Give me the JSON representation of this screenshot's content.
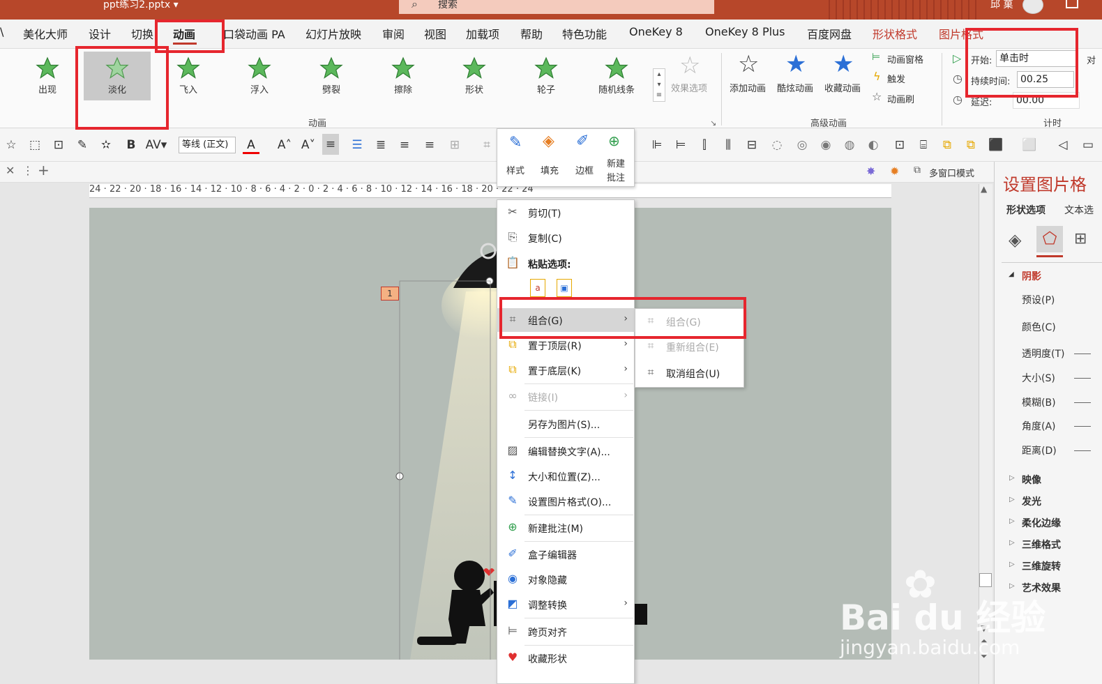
{
  "titlebar": {
    "doc_title": "ppt练习2.pptx ▾",
    "search_placeholder": "搜索",
    "user_name": "邱 菓"
  },
  "tabs": [
    {
      "label": "美化大师"
    },
    {
      "label": "设计"
    },
    {
      "label": "切换"
    },
    {
      "label": "动画"
    },
    {
      "label": "口袋动画 PA"
    },
    {
      "label": "幻灯片放映"
    },
    {
      "label": "审阅"
    },
    {
      "label": "视图"
    },
    {
      "label": "加载项"
    },
    {
      "label": "帮助"
    },
    {
      "label": "特色功能"
    },
    {
      "label": "OneKey 8"
    },
    {
      "label": "OneKey 8 Plus"
    },
    {
      "label": "百度网盘"
    },
    {
      "label": "形状格式"
    },
    {
      "label": "图片格式"
    }
  ],
  "ribbon": {
    "animations": [
      {
        "label": "出现"
      },
      {
        "label": "淡化"
      },
      {
        "label": "飞入"
      },
      {
        "label": "浮入"
      },
      {
        "label": "劈裂"
      },
      {
        "label": "擦除"
      },
      {
        "label": "形状"
      },
      {
        "label": "轮子"
      },
      {
        "label": "随机线条"
      }
    ],
    "effect_options": "效果选项",
    "group_animation": "动画",
    "add_animation": "添加动画",
    "cool_animation": "酷炫动画",
    "fav_animation": "收藏动画",
    "anim_pane": "动画窗格",
    "trigger": "触发",
    "anim_brush": "动画刷",
    "group_advanced": "高级动画",
    "start_label": "开始:",
    "start_value": "单击时",
    "duration_label": "持续时间:",
    "duration_value": "00.25",
    "delay_label": "延迟:",
    "delay_value": "00.00",
    "group_timing": "计时",
    "reorder_partial": "对"
  },
  "fmtbar": {
    "font_name": "等线 (正文)"
  },
  "tabstrip": {
    "multiwindow": "多窗口模式"
  },
  "ruler": {
    "text": "24 · 22 · 20 · 18 · 16 · 14 · 12 · 10 · 8 · 6 · 4 · 2 · 0 · 2 · 4 · 6 · 8 · 10 · 12 · 14 · 16 · 18 · 20 · 22 · 24"
  },
  "slide": {
    "anim_tag": "1"
  },
  "mini_toolbar": {
    "style": "样式",
    "fill": "填充",
    "border": "边框",
    "new_comment_1": "新建",
    "new_comment_2": "批注"
  },
  "context_menu": {
    "cut": "剪切(T)",
    "copy": "复制(C)",
    "paste_options": "粘贴选项:",
    "group": "组合(G)",
    "bring_front": "置于顶层(R)",
    "send_back": "置于底层(K)",
    "link": "链接(I)",
    "save_as_picture": "另存为图片(S)...",
    "edit_alt_text": "编辑替换文字(A)...",
    "size_position": "大小和位置(Z)...",
    "format_picture": "设置图片格式(O)...",
    "new_comment": "新建批注(M)",
    "box_editor": "盒子编辑器",
    "hide_object": "对象隐藏",
    "adjust_convert": "调整转换",
    "cross_page_align": "跨页对齐",
    "fav_shape": "收藏形状"
  },
  "submenu": {
    "group": "组合(G)",
    "regroup": "重新组合(E)",
    "ungroup": "取消组合(U)"
  },
  "pane": {
    "title": "设置图片格",
    "tab_shape": "形状选项",
    "tab_text": "文本选",
    "section_shadow": "阴影",
    "preset": "预设(P)",
    "color": "颜色(C)",
    "transparency": "透明度(T)",
    "size": "大小(S)",
    "blur": "模糊(B)",
    "angle": "角度(A)",
    "distance": "距离(D)",
    "reflection": "映像",
    "glow": "发光",
    "soft_edges": "柔化边缘",
    "format_3d": "三维格式",
    "rotation_3d": "三维旋转",
    "artistic": "艺术效果"
  },
  "watermark": {
    "brand": "Bai du 经验",
    "url": "jingyan.baidu.com"
  },
  "colors": {
    "accent": "#b7472a",
    "highlight": "#e6262e",
    "star_green": "#4caf50"
  }
}
